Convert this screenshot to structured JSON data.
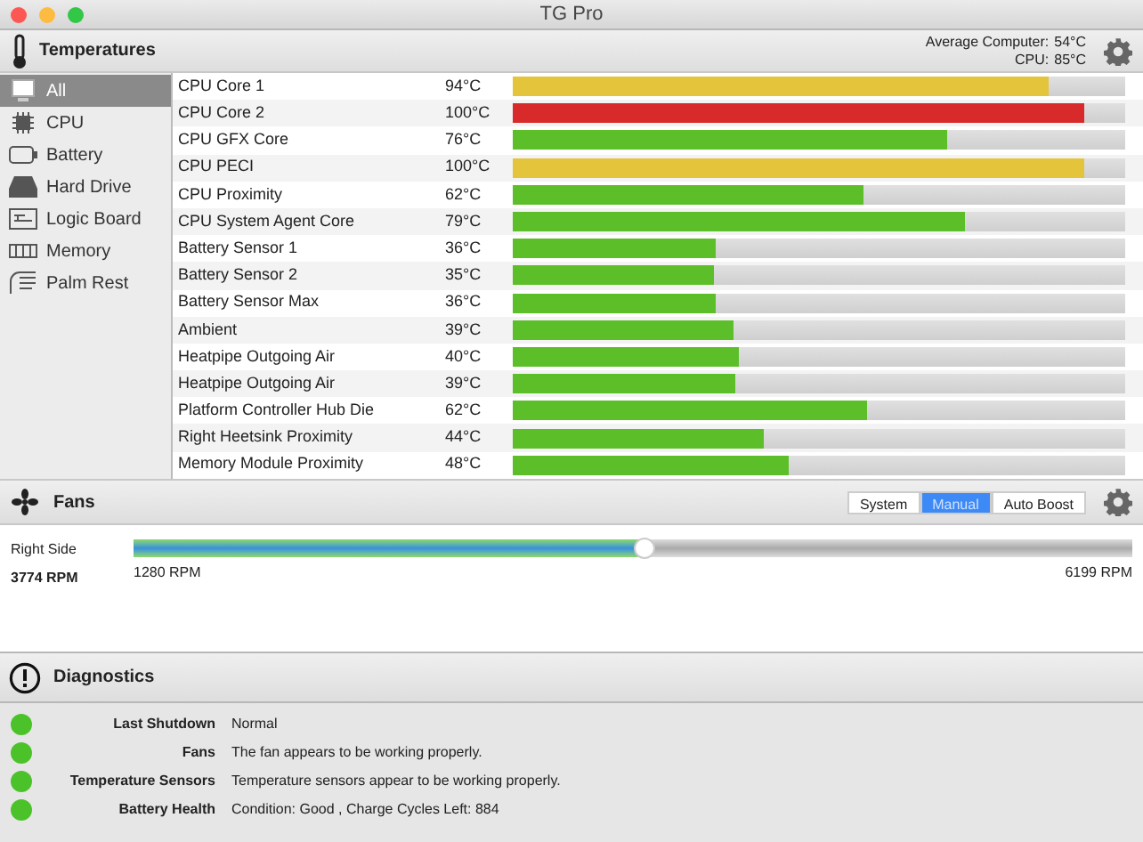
{
  "window": {
    "title": "TG Pro"
  },
  "temperatures": {
    "title": "Temperatures",
    "summary": [
      {
        "label": "Average Computer:",
        "value": "54°C"
      },
      {
        "label": "CPU:",
        "value": "85°C"
      }
    ],
    "sidebar": [
      {
        "label": "All",
        "kind": "all",
        "selected": true
      },
      {
        "label": "CPU",
        "kind": "cpu",
        "selected": false
      },
      {
        "label": "Battery",
        "kind": "battery",
        "selected": false
      },
      {
        "label": "Hard Drive",
        "kind": "drive",
        "selected": false
      },
      {
        "label": "Logic Board",
        "kind": "board",
        "selected": false
      },
      {
        "label": "Memory",
        "kind": "memory",
        "selected": false
      },
      {
        "label": "Palm Rest",
        "kind": "palm",
        "selected": false
      }
    ],
    "sensors": [
      {
        "name": "CPU Core 1",
        "value": "94°C",
        "level": 0.875,
        "color": "#e3c43a"
      },
      {
        "name": "CPU Core 2",
        "value": "100°C",
        "level": 0.933,
        "color": "#d82a2a"
      },
      {
        "name": "CPU GFX Core",
        "value": "76°C",
        "level": 0.709,
        "color": "#5cbf2a"
      },
      {
        "name": "CPU PECI",
        "value": "100°C",
        "level": 0.933,
        "color": "#e3c43a"
      },
      {
        "name": "CPU Proximity",
        "value": "62°C",
        "level": 0.573,
        "color": "#5cbf2a"
      },
      {
        "name": "CPU System Agent Core",
        "value": "79°C",
        "level": 0.738,
        "color": "#5cbf2a"
      },
      {
        "name": "Battery Sensor 1",
        "value": "36°C",
        "level": 0.331,
        "color": "#5cbf2a"
      },
      {
        "name": "Battery Sensor 2",
        "value": "35°C",
        "level": 0.328,
        "color": "#5cbf2a"
      },
      {
        "name": "Battery Sensor Max",
        "value": "36°C",
        "level": 0.331,
        "color": "#5cbf2a"
      },
      {
        "name": "Ambient",
        "value": "39°C",
        "level": 0.36,
        "color": "#5cbf2a"
      },
      {
        "name": "Heatpipe Outgoing Air",
        "value": "40°C",
        "level": 0.37,
        "color": "#5cbf2a"
      },
      {
        "name": "Heatpipe Outgoing Air",
        "value": "39°C",
        "level": 0.363,
        "color": "#5cbf2a"
      },
      {
        "name": "Platform Controller Hub Die",
        "value": "62°C",
        "level": 0.578,
        "color": "#5cbf2a"
      },
      {
        "name": "Right Heetsink Proximity",
        "value": "44°C",
        "level": 0.41,
        "color": "#5cbf2a"
      },
      {
        "name": "Memory Module Proximity",
        "value": "48°C",
        "level": 0.45,
        "color": "#5cbf2a"
      }
    ]
  },
  "fans": {
    "title": "Fans",
    "modes": [
      {
        "label": "System",
        "selected": false
      },
      {
        "label": "Manual",
        "selected": true
      },
      {
        "label": "Auto Boost",
        "selected": false
      }
    ],
    "items": [
      {
        "name": "Right Side",
        "speed": "3774 RPM",
        "min": "1280 RPM",
        "max": "6199 RPM",
        "level": 0.512
      }
    ]
  },
  "diagnostics": {
    "title": "Diagnostics",
    "items": [
      {
        "label": "Last Shutdown",
        "text": "Normal",
        "color": "#4cc22a"
      },
      {
        "label": "Fans",
        "text": "The fan appears to be working properly.",
        "color": "#4cc22a"
      },
      {
        "label": "Temperature Sensors",
        "text": "Temperature sensors appear to be working properly.",
        "color": "#4cc22a"
      },
      {
        "label": "Battery Health",
        "text": "Condition: Good , Charge Cycles Left: 884",
        "color": "#4cc22a"
      }
    ]
  }
}
